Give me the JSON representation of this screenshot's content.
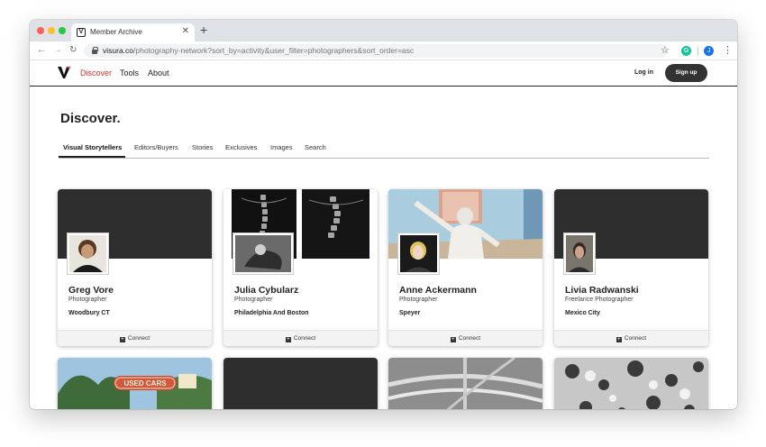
{
  "browser": {
    "tab_title": "Member Archive",
    "tab_favicon": "V",
    "url_domain": "visura.co",
    "url_path": "/photography-network?sort_by=activity&user_filter=photographers&sort_order=asc",
    "profile_initial": "J"
  },
  "site": {
    "logo": "V",
    "nav": [
      "Discover",
      "Tools",
      "About"
    ],
    "login_label": "Log in",
    "signup_label": "Sign up"
  },
  "page": {
    "title": "Discover.",
    "tabs": [
      "Visual Storytellers",
      "Editors/Buyers",
      "Stories",
      "Exclusives",
      "Images",
      "Search"
    ],
    "active_tab": "Visual Storytellers"
  },
  "cards": [
    {
      "name": "Greg Vore",
      "role": "Photographer",
      "location": "Woodbury CT",
      "connect_label": "Connect"
    },
    {
      "name": "Julia Cybularz",
      "role": "Photographer",
      "location": "Philadelphia And Boston",
      "connect_label": "Connect"
    },
    {
      "name": "Anne Ackermann",
      "role": "Photographer",
      "location": "Speyer",
      "connect_label": "Connect"
    },
    {
      "name": "Livia Radwanski",
      "role": "Freelance Photographer",
      "location": "Mexico City",
      "connect_label": "Connect"
    }
  ],
  "second_row": {
    "sign_text": "USED CARS"
  },
  "colors": {
    "accent": "#d0312d",
    "dark": "#333333"
  }
}
